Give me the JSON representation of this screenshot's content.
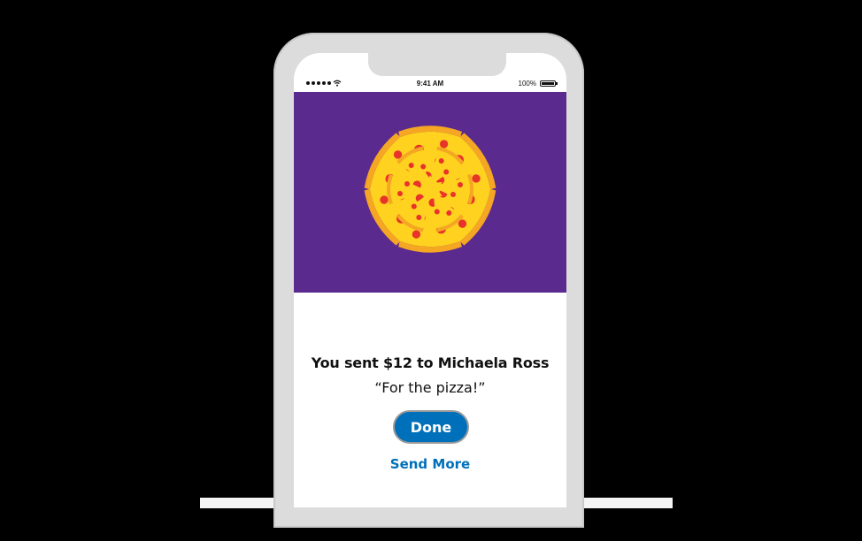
{
  "status_bar": {
    "time": "9:41 AM",
    "battery": "100%"
  },
  "confirmation": {
    "headline": "You sent $12 to Michaela Ross",
    "memo": "“For the pizza!”",
    "done_label": "Done",
    "send_more_label": "Send More"
  },
  "colors": {
    "background": "#000000",
    "art_background": "#5b2a8e",
    "pizza_cheese": "#ffd21f",
    "pizza_crust": "#f5a623",
    "pepperoni": "#e8332a",
    "brand_blue": "#0070ba"
  },
  "icons": [
    "signal-dots-icon",
    "wifi-icon",
    "battery-icon"
  ]
}
